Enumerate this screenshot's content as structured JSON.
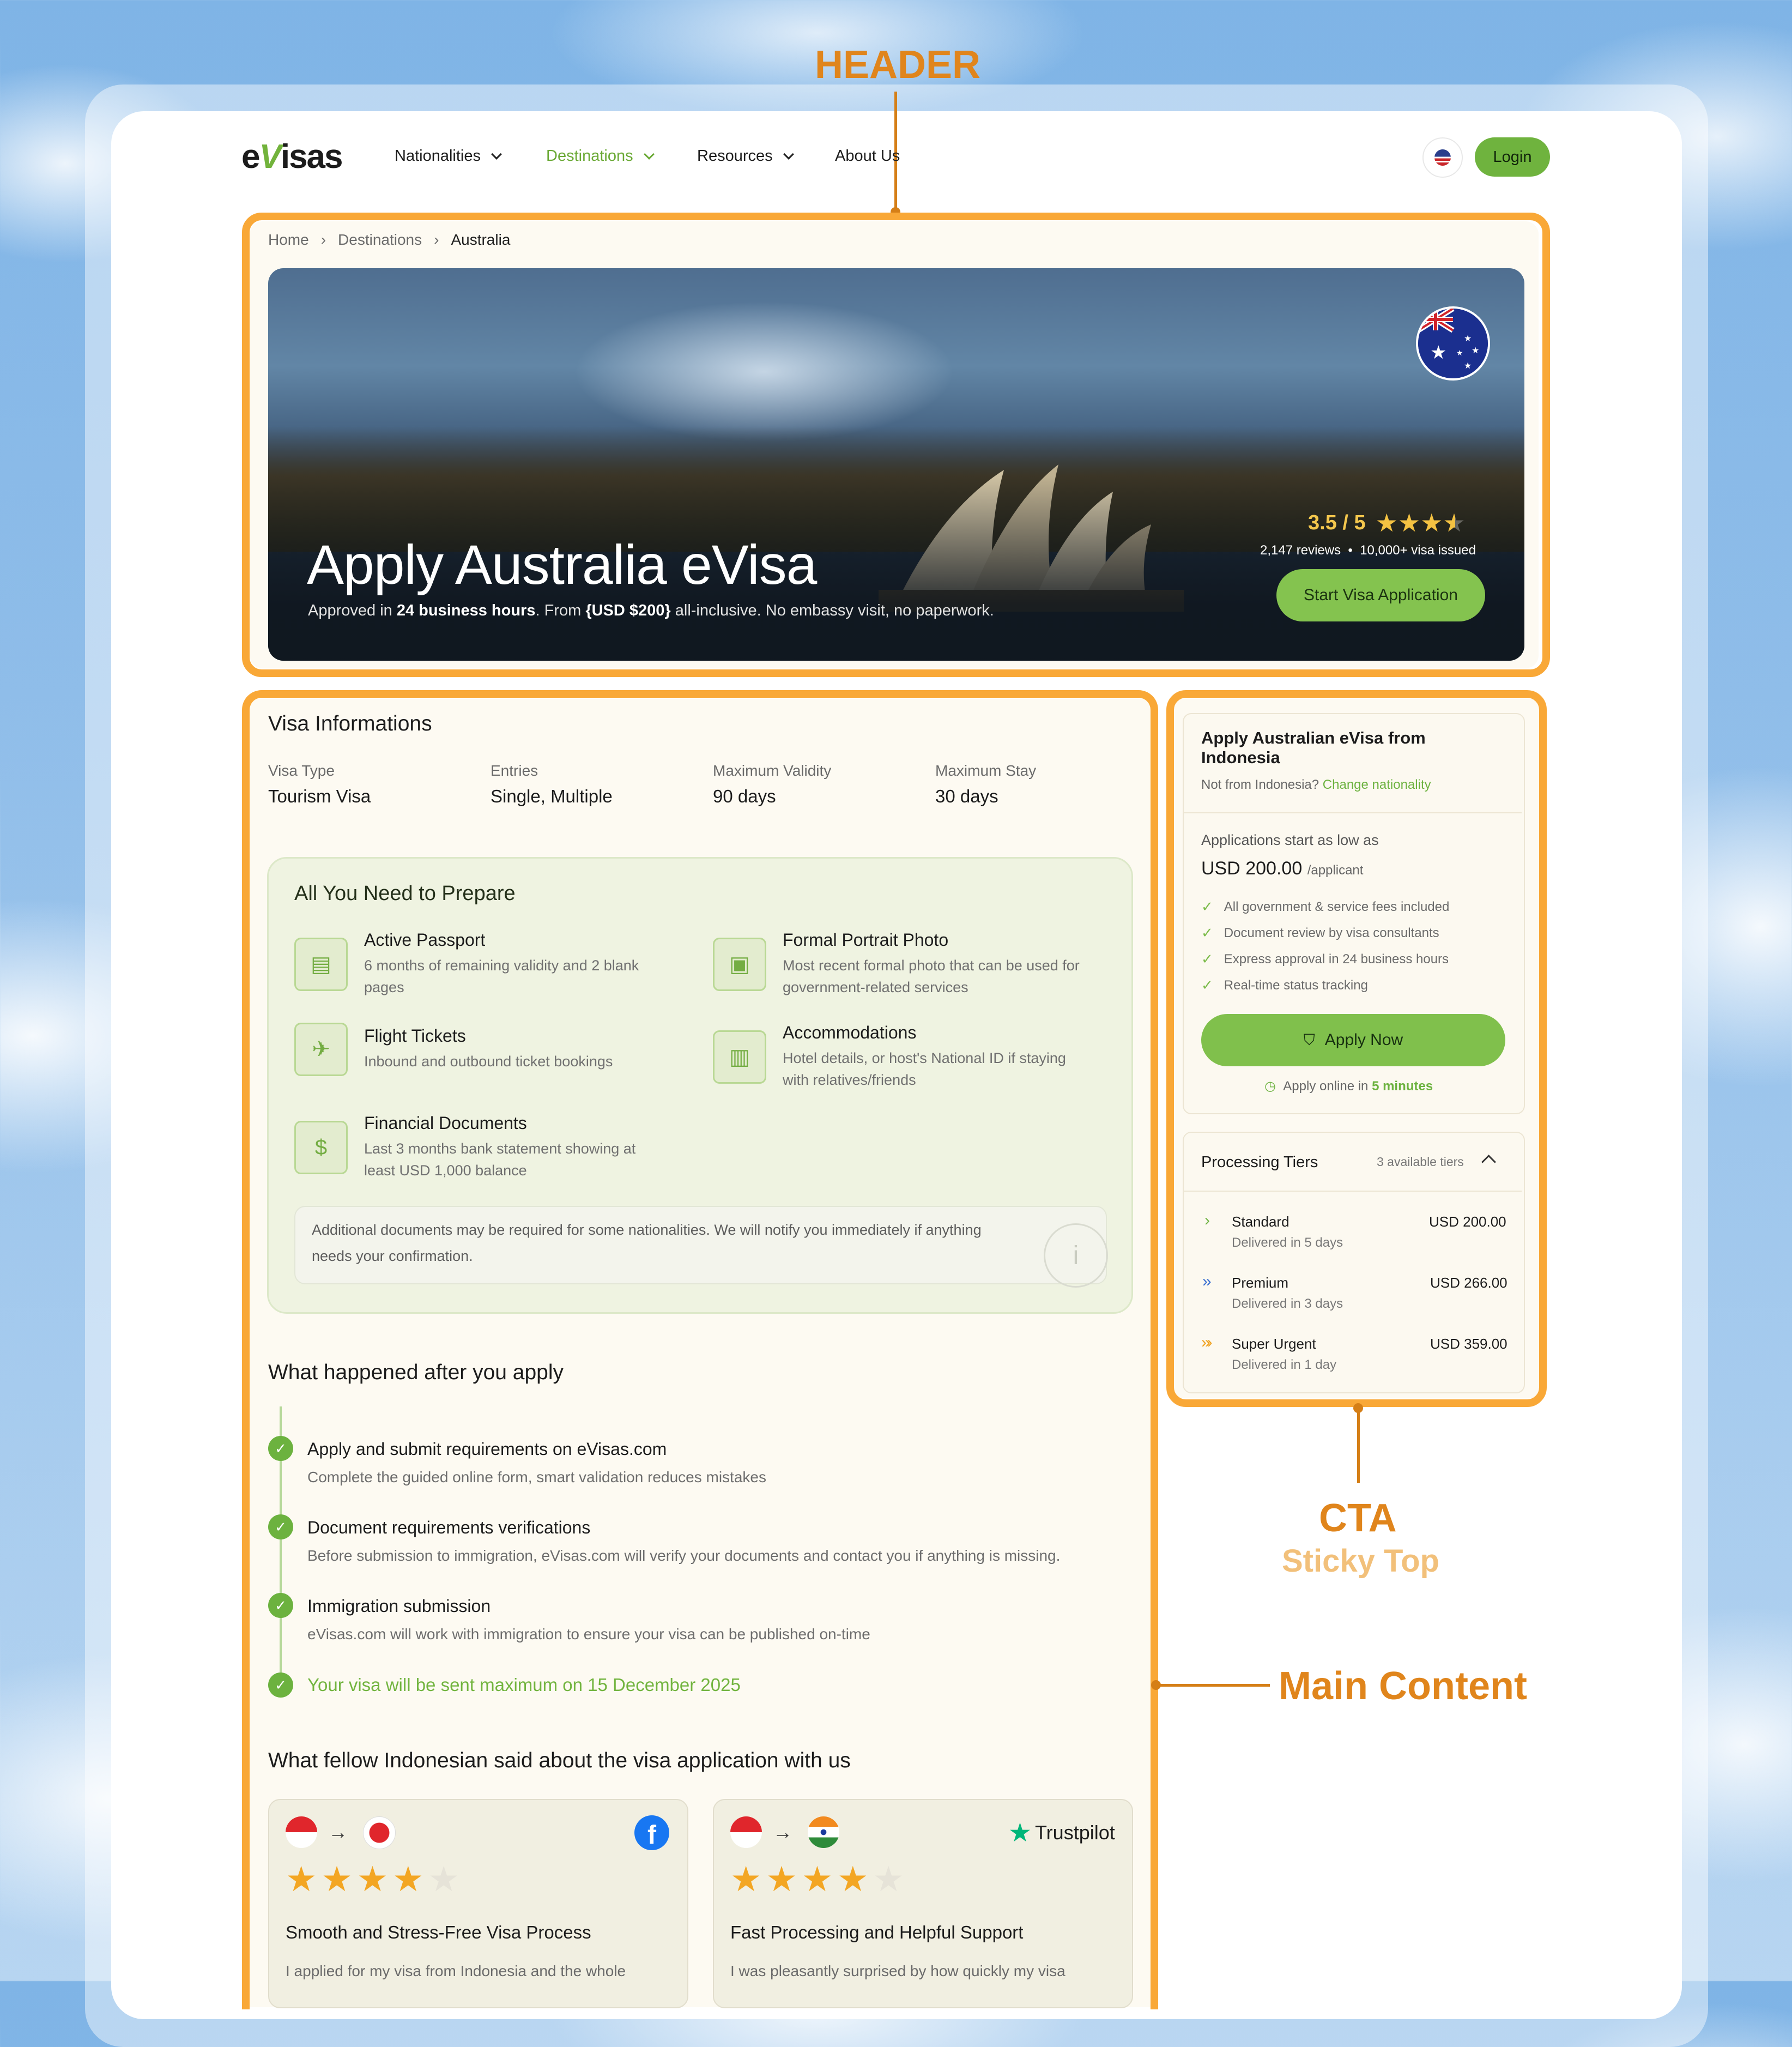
{
  "annotations": {
    "header": "HEADER",
    "cta": "CTA",
    "cta_sub": "Sticky Top",
    "main": "Main Content"
  },
  "header": {
    "logo": "eVisas",
    "nav": [
      {
        "label": "Nationalities"
      },
      {
        "label": "Destinations"
      },
      {
        "label": "Resources"
      },
      {
        "label": "About Us"
      }
    ],
    "login": "Login",
    "language_icon": "us-flag-icon"
  },
  "breadcrumb": [
    "Home",
    "Destinations",
    "Australia"
  ],
  "hero": {
    "title": "Apply Australia eVisa",
    "sub_pre": "Approved in ",
    "sub_b1": "24 business hours",
    "sub_mid": ". From ",
    "sub_b2": "{USD $200}",
    "sub_post": " all-inclusive. No embassy visit, no paperwork.",
    "rating_text": "3.5 / 5",
    "rating": 3.5,
    "reviews": "2,147 reviews",
    "issued": "10,000+ visa issued",
    "start_button": "Start Visa Application"
  },
  "visa_info": {
    "heading": "Visa Informations",
    "items": [
      {
        "label": "Visa Type",
        "value": "Tourism Visa"
      },
      {
        "label": "Entries",
        "value": "Single, Multiple"
      },
      {
        "label": "Maximum Validity",
        "value": "90 days"
      },
      {
        "label": "Maximum Stay",
        "value": "30 days"
      }
    ]
  },
  "prepare": {
    "heading": "All You Need to Prepare",
    "items": [
      {
        "title": "Active Passport",
        "desc1": "6 months of remaining validity and 2 blank",
        "desc2": "pages",
        "icon": "passport-icon"
      },
      {
        "title": "Formal Portrait Photo",
        "desc1": "Most recent formal photo that can be used for",
        "desc2": "government-related services",
        "icon": "portrait-icon"
      },
      {
        "title": "Flight Tickets",
        "desc1": "Inbound and outbound ticket bookings",
        "desc2": "",
        "icon": "plane-icon"
      },
      {
        "title": "Accommodations",
        "desc1": "Hotel details, or host's National ID if staying",
        "desc2": "with relatives/friends",
        "icon": "building-icon"
      },
      {
        "title": "Financial Documents",
        "desc1": "Last 3 months bank statement showing at",
        "desc2": "least USD 1,000 balance",
        "icon": "dollar-icon"
      }
    ],
    "note1": "Additional documents may be required for some nationalities. We will notify you immediately if anything",
    "note2": "needs your confirmation."
  },
  "after_apply": {
    "heading": "What happened after you apply",
    "steps": [
      {
        "title": "Apply and submit requirements on eVisas.com",
        "desc": "Complete the guided online form, smart validation reduces mistakes"
      },
      {
        "title": "Document requirements verifications",
        "desc": "Before submission to immigration, eVisas.com will verify your documents and contact you if anything is missing."
      },
      {
        "title": "Immigration submission",
        "desc": "eVisas.com will work with immigration to ensure your visa can be published on-time"
      }
    ],
    "final": "Your visa will be sent maximum on 15 December 2025"
  },
  "reviews_section": {
    "heading": "What fellow Indonesian said about the visa application with us",
    "cards": [
      {
        "source_icon": "facebook-icon",
        "stars": 4,
        "title": "Smooth and Stress-Free Visa Process",
        "text": "I applied for my visa from Indonesia and the whole"
      },
      {
        "source_icon": "trustpilot-icon",
        "source": "Trustpilot",
        "stars": 4,
        "title": "Fast Processing and Helpful Support",
        "text": "I was pleasantly surprised by how quickly my visa"
      }
    ]
  },
  "cta": {
    "title1": "Apply Australian eVisa from",
    "title2": "Indonesia",
    "not_from": "Not from Indonesia?",
    "change": "Change nationality",
    "start_low": "Applications start as low as",
    "price": "USD 200.00",
    "per": "/applicant",
    "features": [
      "All government & service fees included",
      "Document review by visa consultants",
      "Express approval in 24 business hours",
      "Real-time status tracking"
    ],
    "apply": "Apply Now",
    "apply_online": "Apply online in ",
    "minutes": "5 minutes",
    "tiers_heading": "Processing Tiers",
    "tiers_count": "3 available tiers",
    "tiers": [
      {
        "name": "Standard",
        "sub": "Delivered in 5 days",
        "price": "USD 200.00"
      },
      {
        "name": "Premium",
        "sub": "Delivered in 3 days",
        "price": "USD 266.00"
      },
      {
        "name": "Super Urgent",
        "sub": "Delivered in 1 day",
        "price": "USD 359.00"
      }
    ]
  }
}
